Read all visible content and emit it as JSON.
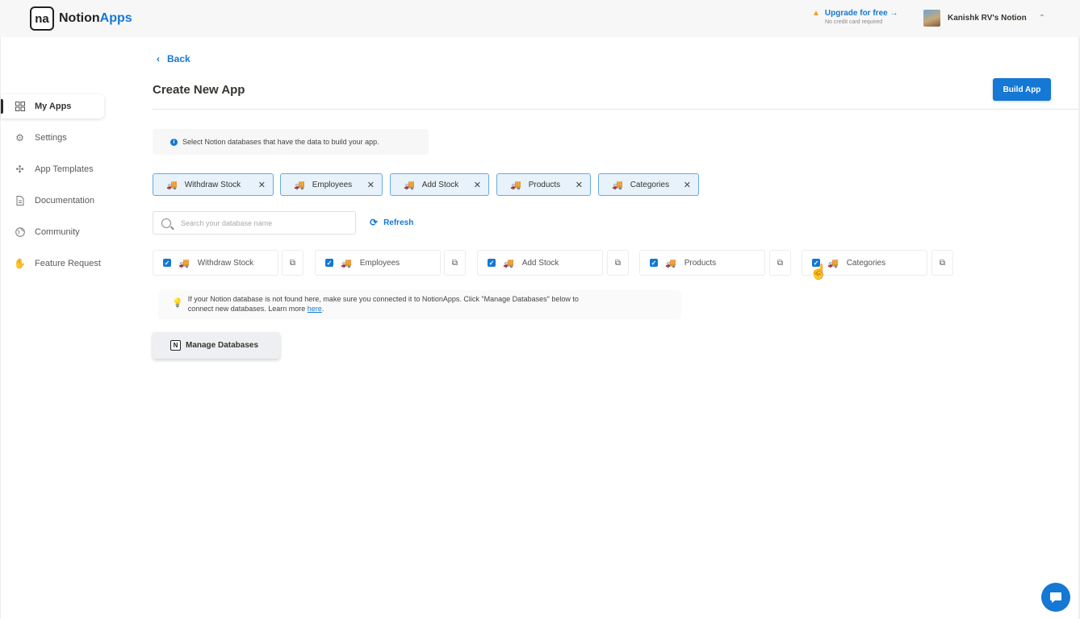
{
  "header": {
    "logo_mark": "na",
    "logo_name_part1": "Notion",
    "logo_name_part2": "Apps",
    "upgrade_label": "Upgrade for free →",
    "upgrade_sub": "No credit card required",
    "workspace_name": "Kanishk RV's Notion"
  },
  "sidebar": {
    "items": [
      {
        "label": "My Apps",
        "icon": "grid-icon",
        "active": true
      },
      {
        "label": "Settings",
        "icon": "gear-icon"
      },
      {
        "label": "App Templates",
        "icon": "templates-icon"
      },
      {
        "label": "Documentation",
        "icon": "document-icon"
      },
      {
        "label": "Community",
        "icon": "globe-icon"
      },
      {
        "label": "Feature Request",
        "icon": "hand-icon"
      }
    ]
  },
  "main": {
    "back_label": "Back",
    "title": "Create New App",
    "build_button": "Build App",
    "info_text": "Select Notion databases that have the data to build your app.",
    "selected_chips": [
      "Withdraw Stock",
      "Employees",
      "Add Stock",
      "Products",
      "Categories"
    ],
    "search_placeholder": "Search your database name",
    "refresh_label": "Refresh",
    "databases": [
      {
        "name": "Withdraw Stock",
        "checked": true
      },
      {
        "name": "Employees",
        "checked": true
      },
      {
        "name": "Add Stock",
        "checked": true
      },
      {
        "name": "Products",
        "checked": true
      },
      {
        "name": "Categories",
        "checked": true
      }
    ],
    "hint_line1": "If your Notion database is not found here, make sure you connected it to NotionApps. Click \"Manage Databases\" below to",
    "hint_line2": "connect new databases. Learn more ",
    "hint_link": "here",
    "hint_end": ".",
    "manage_button": "Manage Databases"
  },
  "colors": {
    "accent": "#1478d4",
    "chip_bg": "#e7f2fb",
    "chip_border": "#6aaae0"
  }
}
